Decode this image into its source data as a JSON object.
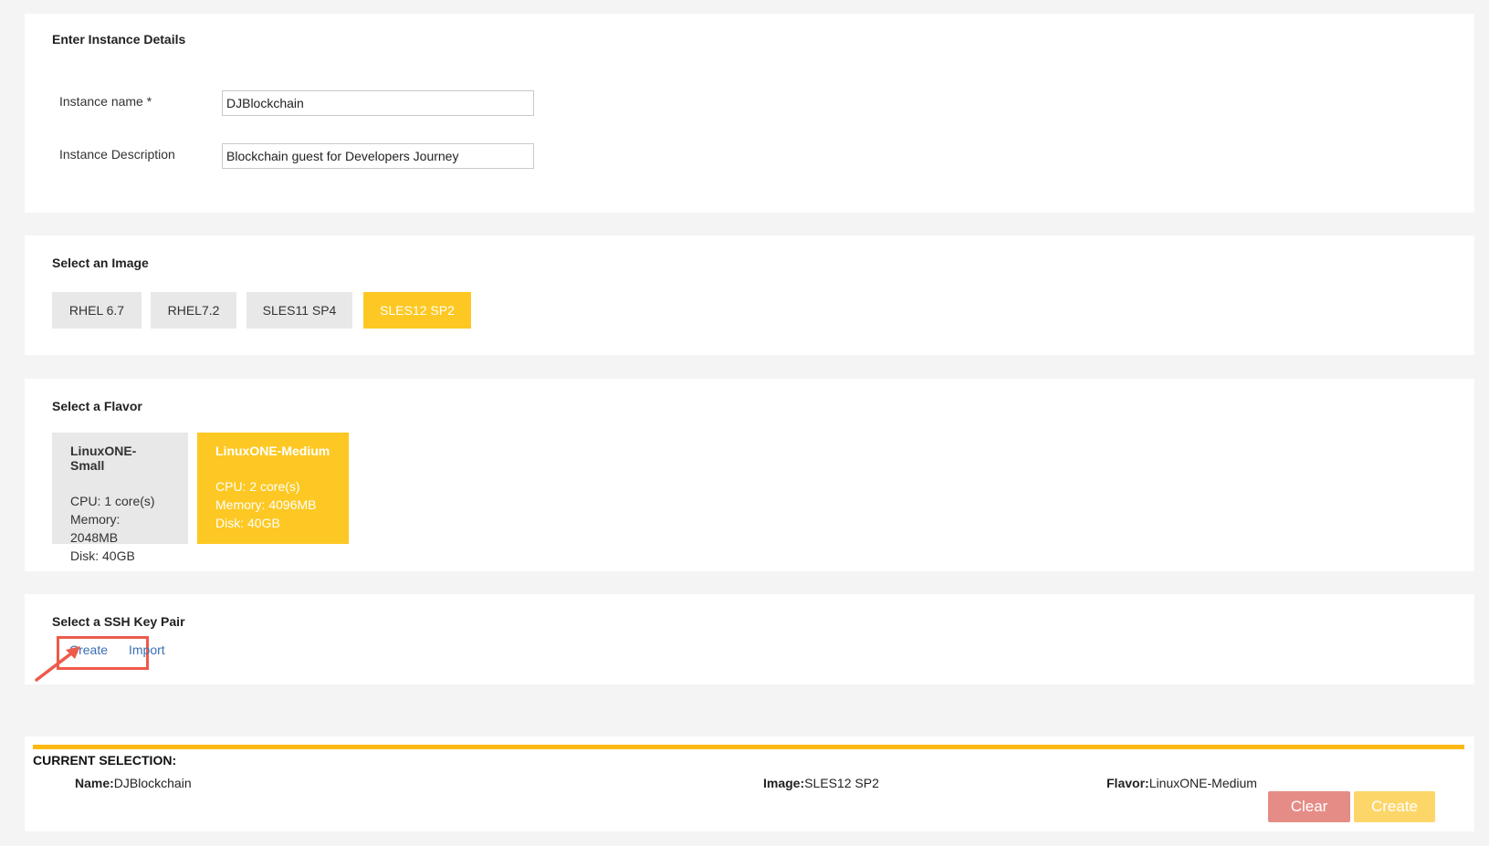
{
  "instance_details": {
    "title": "Enter Instance Details",
    "name_label": "Instance name *",
    "name_value": "DJBlockchain",
    "description_label": "Instance Description",
    "description_value": "Blockchain guest for Developers Journey"
  },
  "image_section": {
    "title": "Select an Image",
    "options": [
      "RHEL 6.7",
      "RHEL7.2",
      "SLES11 SP4",
      "SLES12 SP2"
    ],
    "selected": "SLES12 SP2"
  },
  "flavor_section": {
    "title": "Select a Flavor",
    "flavors": [
      {
        "name": "LinuxONE-Small",
        "cpu": "CPU: 1 core(s)",
        "memory": "Memory: 2048MB",
        "disk": "Disk: 40GB"
      },
      {
        "name": "LinuxONE-Medium",
        "cpu": "CPU: 2 core(s)",
        "memory": "Memory: 4096MB",
        "disk": "Disk: 40GB"
      }
    ],
    "selected": "LinuxONE-Medium"
  },
  "ssh_section": {
    "title": "Select a SSH Key Pair",
    "create_label": "Create",
    "import_label": "Import"
  },
  "current_selection": {
    "title": "CURRENT SELECTION:",
    "name_key": "Name:",
    "name_value": "DJBlockchain",
    "image_key": "Image:",
    "image_value": "SLES12 SP2",
    "flavor_key": "Flavor:",
    "flavor_value": "LinuxONE-Medium",
    "clear_label": "Clear",
    "create_label": "Create"
  },
  "colors": {
    "accent": "#fdc823",
    "summary_bar": "#fdb913",
    "clear_button": "#e58c86",
    "create_button": "#fdd66a",
    "link": "#3a6fb3",
    "annotation": "#ee5a4a"
  },
  "icons": [
    "annotation-arrow-icon"
  ]
}
